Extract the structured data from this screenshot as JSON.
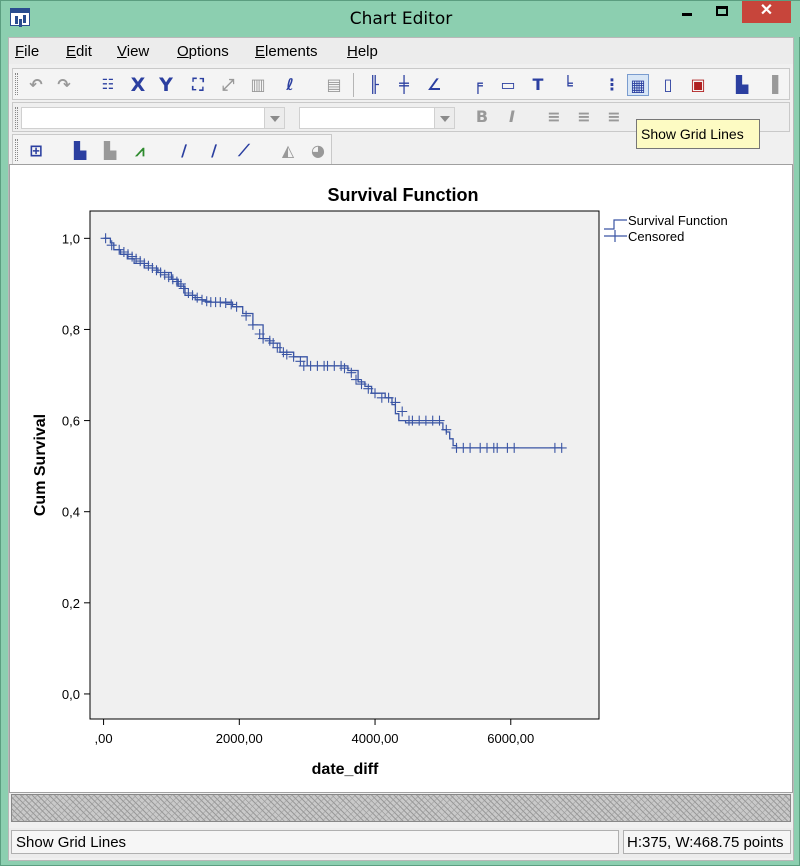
{
  "window": {
    "title": "Chart Editor"
  },
  "menu": [
    {
      "label": "File",
      "key": "F",
      "rest": "ile"
    },
    {
      "label": "Edit",
      "key": "E",
      "rest": "dit"
    },
    {
      "label": "View",
      "key": "V",
      "rest": "iew"
    },
    {
      "label": "Options",
      "key": "O",
      "rest": "ptions"
    },
    {
      "label": "Elements",
      "key": "E",
      "rest": "lements"
    },
    {
      "label": "Help",
      "key": "H",
      "rest": "elp"
    }
  ],
  "toolbar": {
    "icons": [
      "undo-icon",
      "redo-icon",
      "properties-icon",
      "x-axis-icon",
      "y-axis-icon",
      "data-label-mode-icon",
      "rescale-icon",
      "transpose-icon",
      "lasso-icon",
      "show-data-labels-icon",
      "ref-line-x-icon",
      "ref-line-y-icon",
      "ref-line-eq-icon",
      "title-icon",
      "annotation-icon",
      "text-box-icon",
      "footnote-icon",
      "show-derived-axis-icon",
      "show-grid-lines-icon",
      "show-legend-icon",
      "transpose-chart-icon",
      "bar-chart-sort-icon",
      "bar-icon"
    ],
    "bold_label": "B",
    "italic_label": "I",
    "tooltip": "Show Grid Lines"
  },
  "status": {
    "message": "Show Grid Lines",
    "size": "H:375, W:468.75 points"
  },
  "colors": {
    "series": "#3a55a4",
    "plot_bg": "#f0f0f0",
    "accent": "#2b3fa0"
  },
  "chart_data": {
    "type": "line",
    "title": "Survival Function",
    "xlabel": "date_diff",
    "ylabel": "Cum Survival",
    "xlim": [
      -200,
      7300
    ],
    "ylim": [
      -0.055,
      1.06
    ],
    "xticks": [
      0,
      2000,
      4000,
      6000
    ],
    "xtick_labels": [
      ",00",
      "2000,00",
      "4000,00",
      "6000,00"
    ],
    "yticks": [
      0,
      0.2,
      0.4,
      0.6,
      0.8,
      1.0
    ],
    "ytick_labels": [
      "0,0",
      "0,2",
      "0,4",
      "0,6",
      "0,8",
      "1,0"
    ],
    "legend": {
      "position": "right",
      "entries": [
        "Survival Function",
        "Censored"
      ]
    },
    "series": [
      {
        "name": "Survival Function",
        "x": [
          0,
          100,
          150,
          250,
          350,
          450,
          600,
          800,
          1000,
          1100,
          1200,
          1350,
          1500,
          1700,
          1900,
          2050,
          2200,
          2350,
          2450,
          2600,
          2800,
          3000,
          3200,
          3400,
          3600,
          3750,
          3850,
          3950,
          4150,
          4250,
          4300,
          4350,
          4450,
          4600,
          4800,
          5000,
          5050,
          5100,
          5150,
          5200,
          5600,
          6000,
          6400,
          6750
        ],
        "y": [
          1.0,
          0.99,
          0.975,
          0.965,
          0.955,
          0.945,
          0.935,
          0.925,
          0.91,
          0.895,
          0.875,
          0.865,
          0.86,
          0.86,
          0.85,
          0.835,
          0.81,
          0.78,
          0.77,
          0.75,
          0.74,
          0.72,
          0.72,
          0.72,
          0.71,
          0.685,
          0.675,
          0.66,
          0.65,
          0.635,
          0.615,
          0.6,
          0.595,
          0.595,
          0.595,
          0.58,
          0.575,
          0.56,
          0.545,
          0.54,
          0.54,
          0.54,
          0.54,
          0.54
        ]
      },
      {
        "name": "Censored",
        "x": [
          30,
          120,
          230,
          300,
          360,
          420,
          480,
          540,
          600,
          660,
          720,
          780,
          840,
          900,
          960,
          1020,
          1080,
          1140,
          1180,
          1250,
          1310,
          1380,
          1450,
          1520,
          1580,
          1650,
          1720,
          1800,
          1880,
          1960,
          2100,
          2200,
          2300,
          2350,
          2450,
          2500,
          2560,
          2650,
          2700,
          2800,
          2900,
          2950,
          3050,
          3150,
          3250,
          3300,
          3400,
          3500,
          3550,
          3650,
          3720,
          3800,
          3900,
          4000,
          4100,
          4200,
          4300,
          4400,
          4500,
          4550,
          4650,
          4750,
          4850,
          4950,
          5050,
          5200,
          5300,
          5400,
          5550,
          5650,
          5750,
          5800,
          5950,
          6050,
          6650,
          6750
        ],
        "y": [
          1.0,
          0.985,
          0.975,
          0.97,
          0.965,
          0.96,
          0.955,
          0.95,
          0.945,
          0.94,
          0.935,
          0.93,
          0.925,
          0.92,
          0.915,
          0.91,
          0.905,
          0.9,
          0.89,
          0.88,
          0.875,
          0.87,
          0.865,
          0.862,
          0.86,
          0.86,
          0.86,
          0.858,
          0.855,
          0.85,
          0.83,
          0.81,
          0.79,
          0.78,
          0.775,
          0.77,
          0.76,
          0.75,
          0.745,
          0.74,
          0.73,
          0.72,
          0.72,
          0.72,
          0.72,
          0.72,
          0.72,
          0.72,
          0.715,
          0.705,
          0.69,
          0.68,
          0.67,
          0.66,
          0.65,
          0.65,
          0.64,
          0.62,
          0.6,
          0.6,
          0.6,
          0.6,
          0.6,
          0.6,
          0.58,
          0.54,
          0.54,
          0.54,
          0.54,
          0.54,
          0.54,
          0.54,
          0.54,
          0.54,
          0.54,
          0.54
        ]
      }
    ]
  }
}
